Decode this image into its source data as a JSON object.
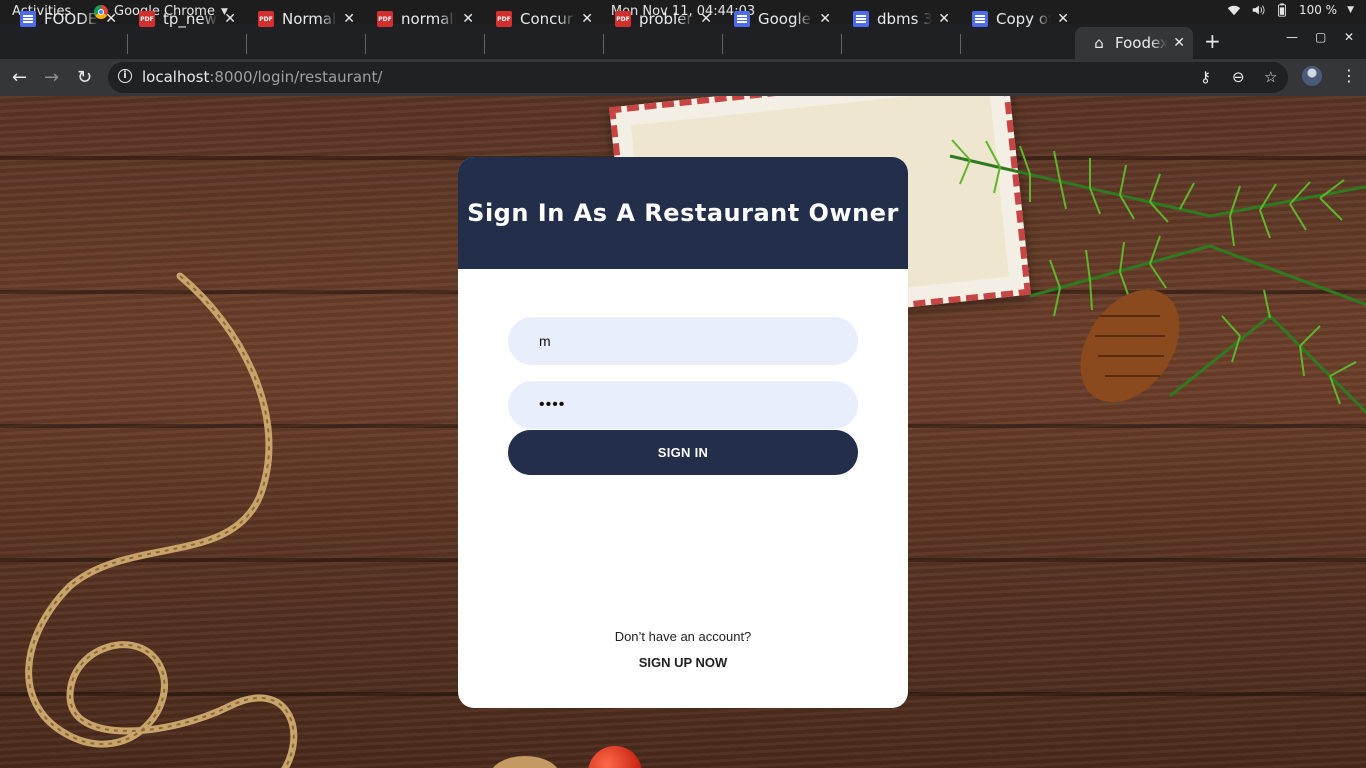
{
  "system": {
    "activities": "Activities",
    "app_name": "Google Chrome",
    "clock": "Mon Nov 11, 04:44:03",
    "battery": "100 %"
  },
  "tabs": [
    {
      "title": "FOODE",
      "icon": "doc-icon"
    },
    {
      "title": "tp_new",
      "icon": "pdf-icon"
    },
    {
      "title": "Normali",
      "icon": "pdf-icon"
    },
    {
      "title": "normali",
      "icon": "pdf-icon"
    },
    {
      "title": "Concurr",
      "icon": "pdf-icon"
    },
    {
      "title": "problem",
      "icon": "pdf-icon"
    },
    {
      "title": "Google",
      "icon": "doc-icon"
    },
    {
      "title": "dbms 3r",
      "icon": "doc-icon"
    },
    {
      "title": "Copy of",
      "icon": "doc-icon"
    },
    {
      "title": "Foodex",
      "icon": "home-icon",
      "active": true
    }
  ],
  "address": {
    "host": "localhost",
    "path": ":8000/login/restaurant/"
  },
  "login": {
    "heading": "Sign In As A Restaurant Owner",
    "username_value": "m",
    "password_value": "••••",
    "signin_label": "SIGN IN",
    "no_account_text": "Don’t have an account?",
    "signup_label": "SIGN UP NOW"
  },
  "colors": {
    "card_header": "#232e4b",
    "input_bg": "#e8eefc",
    "button_bg": "#232e4b"
  }
}
